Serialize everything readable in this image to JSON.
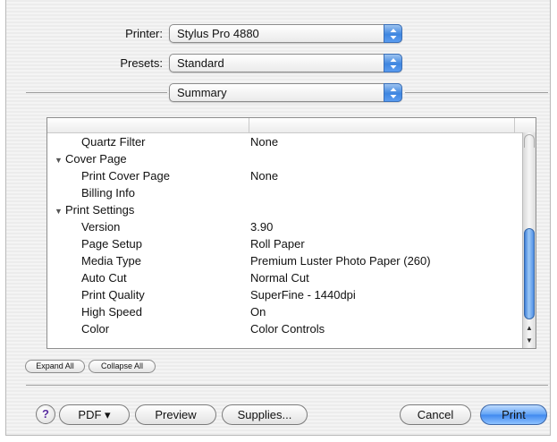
{
  "printer": {
    "label": "Printer:",
    "value": "Stylus Pro 4880"
  },
  "presets": {
    "label": "Presets:",
    "value": "Standard"
  },
  "pane": {
    "value": "Summary"
  },
  "summary_rows": [
    {
      "name": "Quartz Filter",
      "value": "None",
      "level": 1
    },
    {
      "name": "Cover Page",
      "value": "",
      "level": 0,
      "disclosure": true
    },
    {
      "name": "Print Cover Page",
      "value": "None",
      "level": 1
    },
    {
      "name": "Billing Info",
      "value": "",
      "level": 1
    },
    {
      "name": "Print Settings",
      "value": "",
      "level": 0,
      "disclosure": true
    },
    {
      "name": "Version",
      "value": "3.90",
      "level": 1
    },
    {
      "name": "Page Setup",
      "value": "Roll Paper",
      "level": 1
    },
    {
      "name": "Media Type",
      "value": "Premium Luster Photo Paper (260)",
      "level": 1
    },
    {
      "name": "Auto Cut",
      "value": "Normal Cut",
      "level": 1
    },
    {
      "name": "Print Quality",
      "value": "SuperFine - 1440dpi",
      "level": 1
    },
    {
      "name": "High Speed",
      "value": "On",
      "level": 1
    },
    {
      "name": "Color",
      "value": "Color Controls",
      "level": 1
    }
  ],
  "list_buttons": {
    "expand_all": "Expand All",
    "collapse_all": "Collapse All"
  },
  "footer": {
    "help": "?",
    "pdf": "PDF ▾",
    "preview": "Preview",
    "supplies": "Supplies...",
    "cancel": "Cancel",
    "print": "Print"
  }
}
